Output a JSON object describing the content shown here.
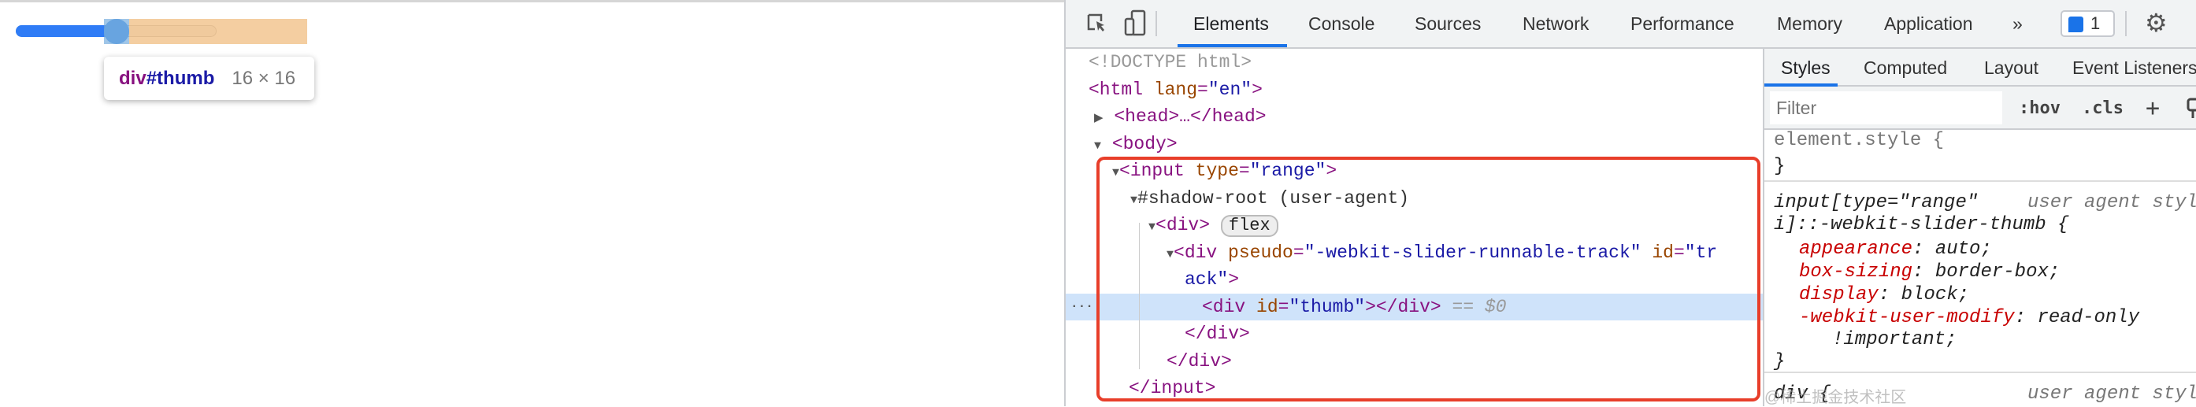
{
  "page": {
    "slider_value_percent": 50,
    "tooltip": {
      "tag": "div",
      "id": "#thumb",
      "size": "16 × 16"
    }
  },
  "devtools": {
    "tabs": [
      "Elements",
      "Console",
      "Sources",
      "Network",
      "Performance",
      "Memory",
      "Application"
    ],
    "active_tab": "Elements",
    "more_tabs": "»",
    "issues_count": "1",
    "tree": {
      "doctype": "<!DOCTYPE html>",
      "html_open": "<html",
      "html_attr": "lang",
      "html_val": "\"en\"",
      "head": "<head>…</head>",
      "body": "<body>",
      "input_open": "<input",
      "input_attr": "type",
      "input_val": "\"range\"",
      "shadow_root": "#shadow-root (user-agent)",
      "div_open": "<div>",
      "flex_badge": "flex",
      "track_open": "<div",
      "track_attr1": "pseudo",
      "track_val1": "\"-webkit-slider-runnable-track\"",
      "track_attr2": "id",
      "track_val2a": "\"tr",
      "track_val2b": "ack\"",
      "thumb_open": "<div",
      "thumb_attr": "id",
      "thumb_val": "\"thumb\"",
      "thumb_close": "></div>",
      "thumb_ref": "== $0",
      "div_close": "</div>",
      "input_close": "</input>",
      "ellipsis": "···"
    },
    "sidebar": {
      "tabs": [
        "Styles",
        "Computed",
        "Layout",
        "Event Listeners"
      ],
      "active_tab": "Styles",
      "filter_placeholder": "Filter",
      "hov": ":hov",
      "cls": ".cls",
      "plus": "+",
      "rules": {
        "element_style": "element.style {",
        "close": "}",
        "selector1a": "input[type=\"range\"",
        "selector1b": "i]::-webkit-slider-thumb {",
        "source": "user agent styl",
        "props": [
          {
            "name": "appearance",
            "value": "auto;"
          },
          {
            "name": "box-sizing",
            "value": "border-box;"
          },
          {
            "name": "display",
            "value": "block;"
          },
          {
            "name": "-webkit-user-modify",
            "value": "read-only"
          }
        ],
        "important": "!important;",
        "selector2": "div {"
      }
    }
  },
  "watermark": "@稀土掘金技术社区",
  "colors": {
    "accent": "#1a73e8",
    "highlight_box": "#e83e2a",
    "tag": "#881280",
    "attr_name": "#994500",
    "attr_value": "#1a1aa6",
    "prop_name": "#c80000"
  }
}
